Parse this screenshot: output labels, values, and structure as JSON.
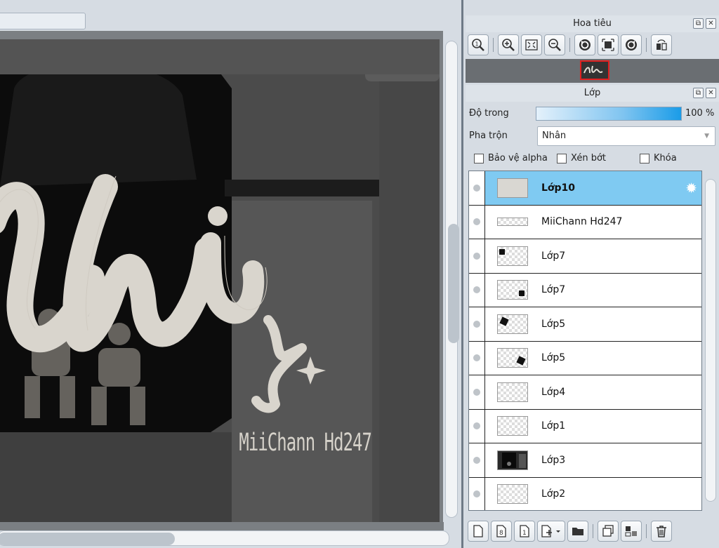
{
  "navigator": {
    "title": "Hoa tiêu",
    "tools": [
      {
        "icon": "zoom-fit-icon"
      },
      {
        "icon": "zoom-in-icon"
      },
      {
        "icon": "fit-screen-icon"
      },
      {
        "icon": "zoom-out-icon"
      },
      {
        "icon": "rotate-left-icon"
      },
      {
        "icon": "reset-rotation-icon"
      },
      {
        "icon": "rotate-right-icon"
      },
      {
        "icon": "flip-horizontal-icon"
      }
    ]
  },
  "layers": {
    "title": "Lớp",
    "opacity_label": "Độ trong",
    "opacity_value": "100 %",
    "opacity": 1.0,
    "blend_label": "Pha trộn",
    "blend_value": "Nhân",
    "protect_alpha": "Bảo vệ alpha",
    "clipping": "Xén bớt",
    "lock": "Khóa",
    "items": [
      {
        "name": "Lớp10",
        "active": true
      },
      {
        "name": "MiiChann Hd247"
      },
      {
        "name": "Lớp7"
      },
      {
        "name": "Lớp7"
      },
      {
        "name": "Lớp5"
      },
      {
        "name": "Lớp5"
      },
      {
        "name": "Lớp4"
      },
      {
        "name": "Lớp1"
      },
      {
        "name": "Lớp3"
      },
      {
        "name": "Lớp2"
      }
    ],
    "bottom_tools": [
      {
        "icon": "new-layer-icon"
      },
      {
        "icon": "new-8bit-layer-icon"
      },
      {
        "icon": "new-1bit-layer-icon"
      },
      {
        "icon": "add-layer-menu-icon"
      },
      {
        "icon": "folder-icon"
      },
      {
        "icon": "duplicate-layer-icon"
      },
      {
        "icon": "merge-down-icon"
      },
      {
        "icon": "delete-layer-icon"
      }
    ]
  },
  "canvas": {
    "artwork_text": "MiiChann Hd247",
    "artwork_script": "hi"
  }
}
